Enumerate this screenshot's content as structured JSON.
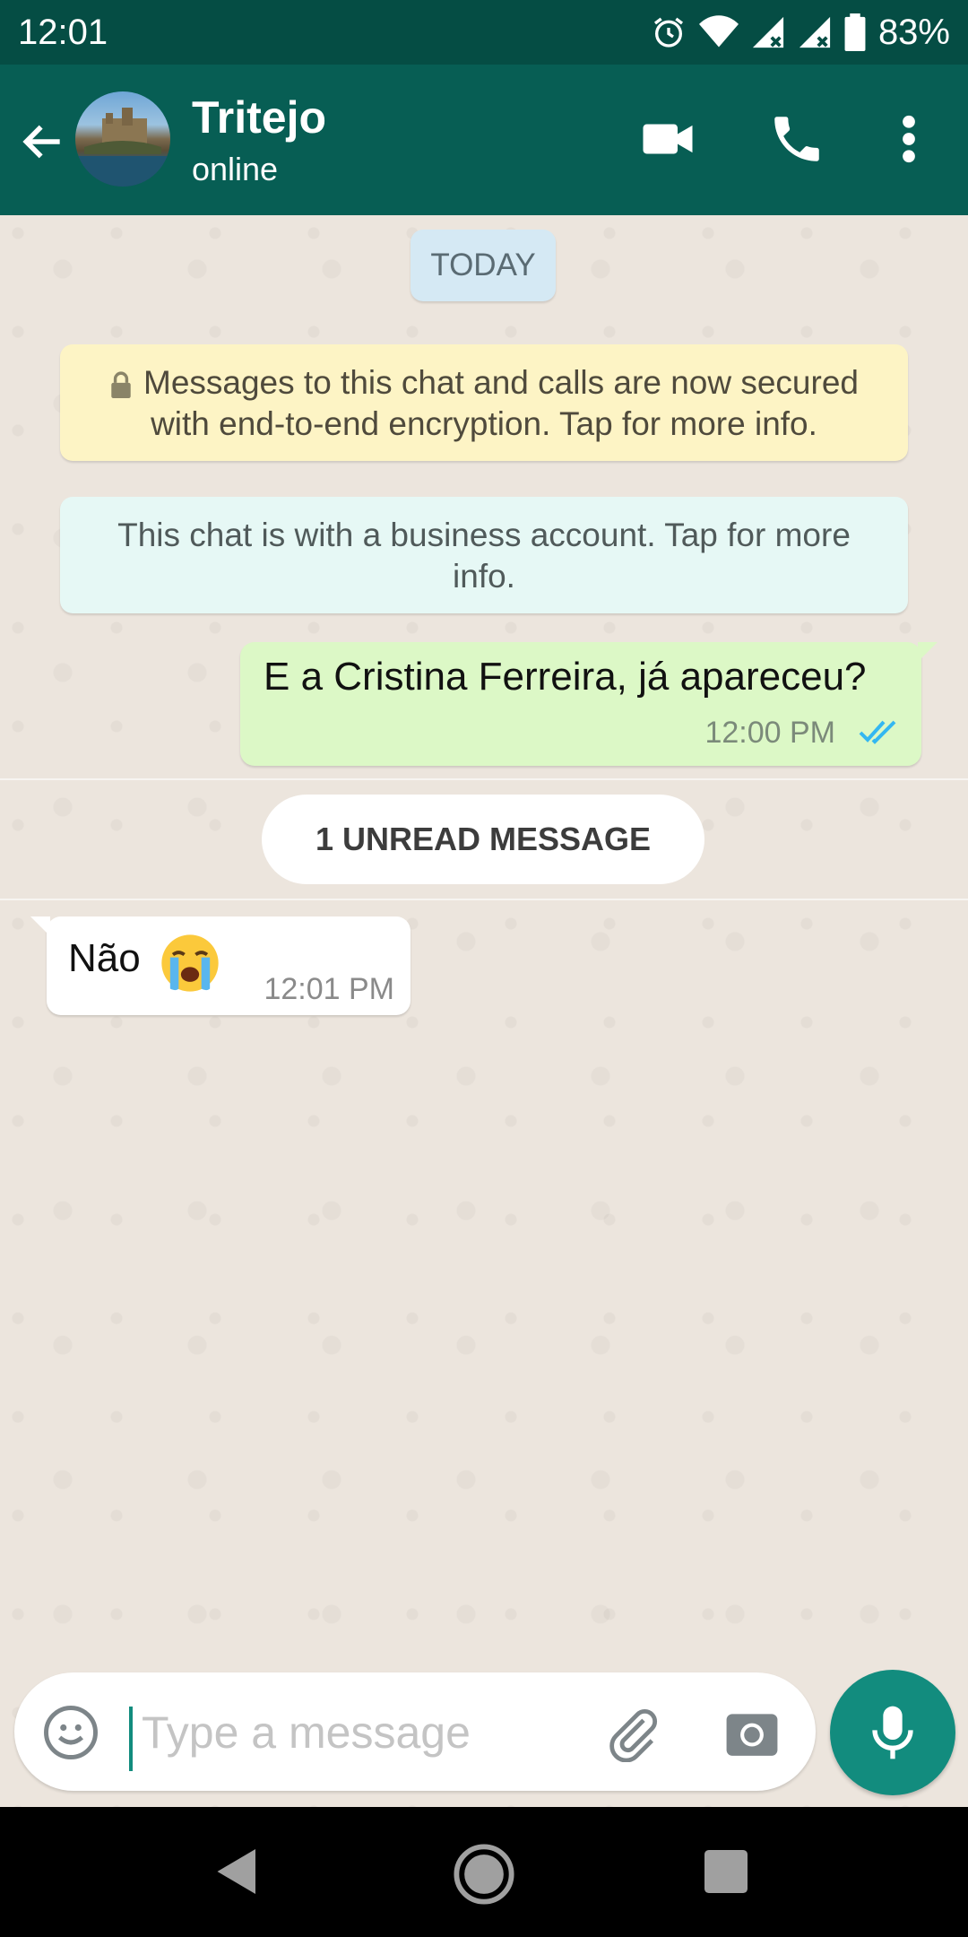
{
  "status_bar": {
    "time": "12:01",
    "battery": "83%"
  },
  "header": {
    "contact_name": "Tritejo",
    "contact_status": "online"
  },
  "chat": {
    "date_chip": "TODAY",
    "encryption_notice": "Messages to this chat and calls are now secured with end-to-end encryption. Tap for more info.",
    "business_notice": "This chat is with a business account. Tap for more info.",
    "unread_divider": "1 UNREAD MESSAGE",
    "messages": [
      {
        "direction": "outgoing",
        "text": "E a Cristina Ferreira, já apareceu?",
        "time": "12:00 PM",
        "status": "read"
      },
      {
        "direction": "incoming",
        "text": "Não",
        "emoji": "loudly-crying-face",
        "time": "12:01 PM"
      }
    ]
  },
  "composer": {
    "placeholder": "Type a message"
  },
  "colors": {
    "header": "#075e54",
    "status_bar": "#054d44",
    "accent": "#128c7e",
    "outgoing_bubble": "#dcf8c6",
    "read_ticks": "#34b7f1"
  },
  "icons": [
    "alarm-icon",
    "wifi-icon",
    "signal-icon",
    "battery-icon",
    "back-arrow-icon",
    "video-call-icon",
    "phone-icon",
    "more-vert-icon",
    "lock-icon",
    "double-check-icon",
    "emoji-icon",
    "attach-icon",
    "camera-icon",
    "mic-icon",
    "nav-back-icon",
    "nav-home-icon",
    "nav-recents-icon"
  ]
}
